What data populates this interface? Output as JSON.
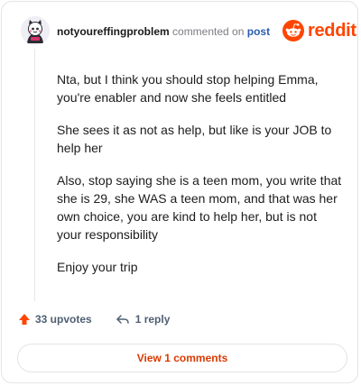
{
  "header": {
    "username": "notyoureffingproblem",
    "commented_text": "commented on",
    "post_link": "post",
    "logo_text": "reddit"
  },
  "comment": {
    "paragraphs": [
      "Nta, but I think you should stop helping Emma, you're enabler and now she feels entitled",
      "She sees it as not as help, but like is your JOB to help her",
      "Also, stop saying she is a teen mom, you write that she is 29, she WAS a teen mom, and that was her own choice, you are kind to help her, but is not your responsibility",
      "Enjoy your trip"
    ]
  },
  "actions": {
    "upvotes": "33 upvotes",
    "replies": "1 reply"
  },
  "footer": {
    "view_comments": "View 1 comments"
  },
  "colors": {
    "brand": "#ff4500",
    "link": "#2a5db0",
    "view_button_text": "#d93a00"
  }
}
